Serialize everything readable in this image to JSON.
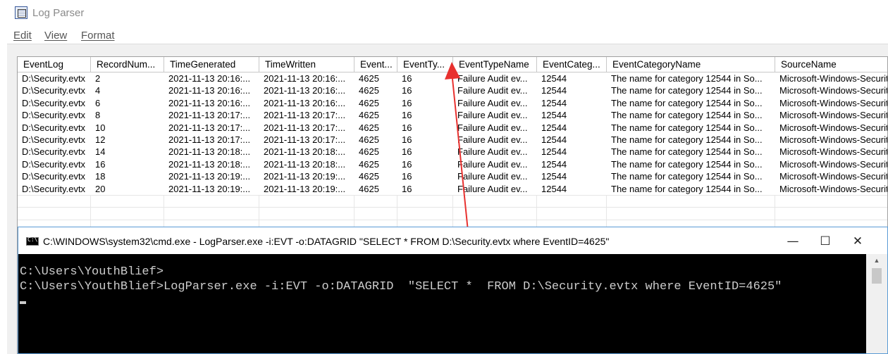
{
  "window": {
    "title": "Log Parser"
  },
  "menu": [
    {
      "label": "Edit"
    },
    {
      "label": "View"
    },
    {
      "label": "Format"
    }
  ],
  "grid": {
    "columns": [
      "EventLog",
      "RecordNum...",
      "TimeGenerated",
      "TimeWritten",
      "Event...",
      "EventTy...",
      "EventTypeName",
      "EventCateg...",
      "EventCategoryName",
      "SourceName"
    ],
    "rows": [
      [
        "D:\\Security.evtx",
        "2",
        "2021-11-13 20:16:...",
        "2021-11-13 20:16:...",
        "4625",
        "16",
        "Failure Audit ev...",
        "12544",
        "The name for category 12544 in So...",
        "Microsoft-Windows-Security-Auditing"
      ],
      [
        "D:\\Security.evtx",
        "4",
        "2021-11-13 20:16:...",
        "2021-11-13 20:16:...",
        "4625",
        "16",
        "Failure Audit ev...",
        "12544",
        "The name for category 12544 in So...",
        "Microsoft-Windows-Security-Auditing"
      ],
      [
        "D:\\Security.evtx",
        "6",
        "2021-11-13 20:16:...",
        "2021-11-13 20:16:...",
        "4625",
        "16",
        "Failure Audit ev...",
        "12544",
        "The name for category 12544 in So...",
        "Microsoft-Windows-Security-Auditing"
      ],
      [
        "D:\\Security.evtx",
        "8",
        "2021-11-13 20:17:...",
        "2021-11-13 20:17:...",
        "4625",
        "16",
        "Failure Audit ev...",
        "12544",
        "The name for category 12544 in So...",
        "Microsoft-Windows-Security-Auditing"
      ],
      [
        "D:\\Security.evtx",
        "10",
        "2021-11-13 20:17:...",
        "2021-11-13 20:17:...",
        "4625",
        "16",
        "Failure Audit ev...",
        "12544",
        "The name for category 12544 in So...",
        "Microsoft-Windows-Security-Auditing"
      ],
      [
        "D:\\Security.evtx",
        "12",
        "2021-11-13 20:17:...",
        "2021-11-13 20:17:...",
        "4625",
        "16",
        "Failure Audit ev...",
        "12544",
        "The name for category 12544 in So...",
        "Microsoft-Windows-Security-Auditing"
      ],
      [
        "D:\\Security.evtx",
        "14",
        "2021-11-13 20:18:...",
        "2021-11-13 20:18:...",
        "4625",
        "16",
        "Failure Audit ev...",
        "12544",
        "The name for category 12544 in So...",
        "Microsoft-Windows-Security-Auditing"
      ],
      [
        "D:\\Security.evtx",
        "16",
        "2021-11-13 20:18:...",
        "2021-11-13 20:18:...",
        "4625",
        "16",
        "Failure Audit ev...",
        "12544",
        "The name for category 12544 in So...",
        "Microsoft-Windows-Security-Auditing"
      ],
      [
        "D:\\Security.evtx",
        "18",
        "2021-11-13 20:19:...",
        "2021-11-13 20:19:...",
        "4625",
        "16",
        "Failure Audit ev...",
        "12544",
        "The name for category 12544 in So...",
        "Microsoft-Windows-Security-Auditing"
      ],
      [
        "D:\\Security.evtx",
        "20",
        "2021-11-13 20:19:...",
        "2021-11-13 20:19:...",
        "4625",
        "16",
        "Failure Audit ev...",
        "12544",
        "The name for category 12544 in So...",
        "Microsoft-Windows-Security-Auditing"
      ]
    ]
  },
  "annotation": {
    "arrow_color": "#e8312f"
  },
  "cmd": {
    "title": "C:\\WINDOWS\\system32\\cmd.exe - LogParser.exe  -i:EVT -o:DATAGRID  \"SELECT *  FROM D:\\Security.evtx where EventID=4625\"",
    "lines": [
      "C:\\Users\\YouthBlief>",
      "C:\\Users\\YouthBlief>LogParser.exe -i:EVT -o:DATAGRID  \"SELECT *  FROM D:\\Security.evtx where EventID=4625\""
    ],
    "controls": {
      "minimize": "—",
      "maximize": "☐",
      "close": "✕"
    },
    "scroll_up": "▲"
  }
}
